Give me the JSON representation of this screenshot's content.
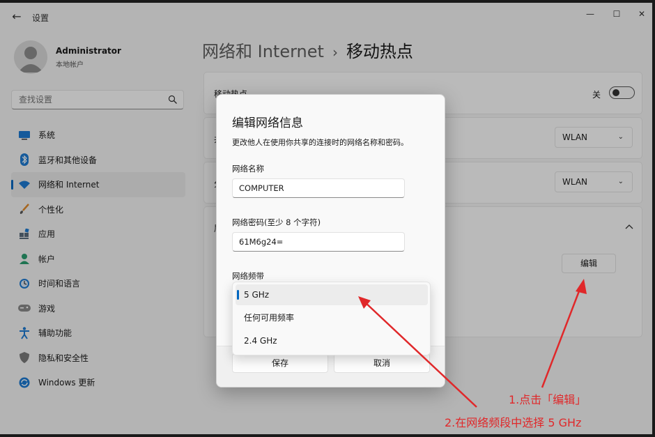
{
  "window": {
    "app_title": "设置",
    "controls": {
      "minimize": "—",
      "maximize": "☐",
      "close": "✕"
    }
  },
  "profile": {
    "name": "Administrator",
    "subtitle": "本地帐户"
  },
  "search": {
    "placeholder": "查找设置"
  },
  "sidebar": {
    "items": [
      {
        "label": "系统",
        "icon": "system-icon"
      },
      {
        "label": "蓝牙和其他设备",
        "icon": "bluetooth-icon"
      },
      {
        "label": "网络和 Internet",
        "icon": "wifi-icon",
        "active": true
      },
      {
        "label": "个性化",
        "icon": "brush-icon"
      },
      {
        "label": "应用",
        "icon": "apps-icon"
      },
      {
        "label": "帐户",
        "icon": "account-icon"
      },
      {
        "label": "时间和语言",
        "icon": "clock-icon"
      },
      {
        "label": "游戏",
        "icon": "gamepad-icon"
      },
      {
        "label": "辅助功能",
        "icon": "accessibility-icon"
      },
      {
        "label": "隐私和安全性",
        "icon": "shield-icon"
      },
      {
        "label": "Windows 更新",
        "icon": "update-icon"
      }
    ]
  },
  "breadcrumb": {
    "parent": "网络和 Internet",
    "separator": "›",
    "current": "移动热点"
  },
  "main": {
    "hotspot_label": "移动热点",
    "hotspot_toggle_label": "关",
    "row2_label": "共",
    "row2_value": "WLAN",
    "row3_label": "分",
    "row3_value": "WLAN",
    "props_label": "属",
    "edit_button": "编辑"
  },
  "dialog": {
    "title": "编辑网络信息",
    "description": "更改他人在使用你共享的连接时的网络名称和密码。",
    "name_label": "网络名称",
    "name_value": "COMPUTER",
    "password_label": "网络密码(至少 8 个字符)",
    "password_value": "61M6g24=",
    "band_label": "网络频带",
    "band_options": [
      "5 GHz",
      "任何可用频率",
      "2.4 GHz"
    ],
    "band_selected": "5 GHz",
    "save_button": "保存",
    "cancel_button": "取消"
  },
  "annotations": {
    "step1": "1.点击「编辑」",
    "step2": "2.在网络频段中选择 5 GHz",
    "color": "#e0282a"
  },
  "colors": {
    "accent": "#0067c0",
    "background": "#f3f3f3"
  }
}
